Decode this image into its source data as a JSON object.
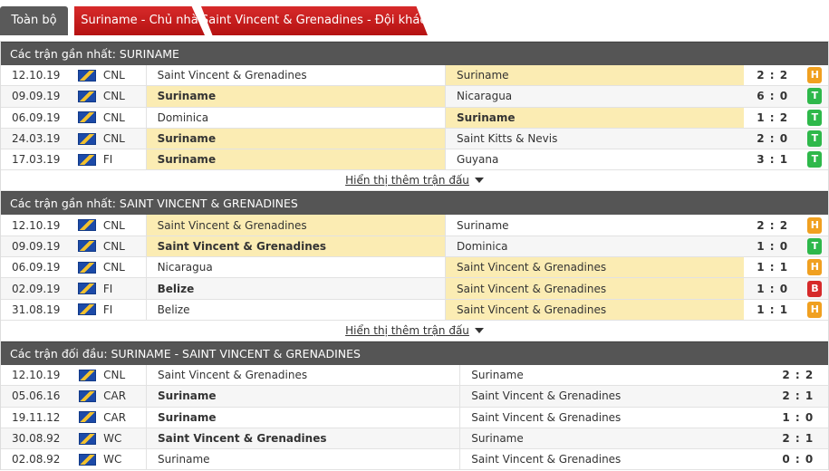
{
  "tabs": [
    {
      "label": "Toàn bộ"
    },
    {
      "label": "Suriname - Chủ nhà"
    },
    {
      "label": "Saint Vincent & Grenadines - Đội khách"
    }
  ],
  "show_more_label": "Hiển thị thêm trận đấu",
  "sections": [
    {
      "title": "Các trận gần nhất: SURINAME",
      "rows": [
        {
          "date": "12.10.19",
          "comp": "CNL",
          "home": "Saint Vincent & Grenadines",
          "home_bold": false,
          "home_hl": false,
          "away": "Suriname",
          "away_bold": false,
          "away_hl": true,
          "score": "2 : 2",
          "result": "H"
        },
        {
          "date": "09.09.19",
          "comp": "CNL",
          "home": "Suriname",
          "home_bold": true,
          "home_hl": true,
          "away": "Nicaragua",
          "away_bold": false,
          "away_hl": false,
          "score": "6 : 0",
          "result": "T"
        },
        {
          "date": "06.09.19",
          "comp": "CNL",
          "home": "Dominica",
          "home_bold": false,
          "home_hl": false,
          "away": "Suriname",
          "away_bold": true,
          "away_hl": true,
          "score": "1 : 2",
          "result": "T"
        },
        {
          "date": "24.03.19",
          "comp": "CNL",
          "home": "Suriname",
          "home_bold": true,
          "home_hl": true,
          "away": "Saint Kitts & Nevis",
          "away_bold": false,
          "away_hl": false,
          "score": "2 : 0",
          "result": "T"
        },
        {
          "date": "17.03.19",
          "comp": "FI",
          "home": "Suriname",
          "home_bold": true,
          "home_hl": true,
          "away": "Guyana",
          "away_bold": false,
          "away_hl": false,
          "score": "3 : 1",
          "result": "T"
        }
      ]
    },
    {
      "title": "Các trận gần nhất: SAINT VINCENT & GRENADINES",
      "rows": [
        {
          "date": "12.10.19",
          "comp": "CNL",
          "home": "Saint Vincent & Grenadines",
          "home_bold": false,
          "home_hl": true,
          "away": "Suriname",
          "away_bold": false,
          "away_hl": false,
          "score": "2 : 2",
          "result": "H"
        },
        {
          "date": "09.09.19",
          "comp": "CNL",
          "home": "Saint Vincent & Grenadines",
          "home_bold": true,
          "home_hl": true,
          "away": "Dominica",
          "away_bold": false,
          "away_hl": false,
          "score": "1 : 0",
          "result": "T"
        },
        {
          "date": "06.09.19",
          "comp": "CNL",
          "home": "Nicaragua",
          "home_bold": false,
          "home_hl": false,
          "away": "Saint Vincent & Grenadines",
          "away_bold": false,
          "away_hl": true,
          "score": "1 : 1",
          "result": "H"
        },
        {
          "date": "02.09.19",
          "comp": "FI",
          "home": "Belize",
          "home_bold": true,
          "home_hl": false,
          "away": "Saint Vincent & Grenadines",
          "away_bold": false,
          "away_hl": true,
          "score": "1 : 0",
          "result": "B"
        },
        {
          "date": "31.08.19",
          "comp": "FI",
          "home": "Belize",
          "home_bold": false,
          "home_hl": false,
          "away": "Saint Vincent & Grenadines",
          "away_bold": false,
          "away_hl": true,
          "score": "1 : 1",
          "result": "H"
        }
      ]
    },
    {
      "title": "Các trận đối đầu: SURINAME - SAINT VINCENT & GRENADINES",
      "rows": [
        {
          "date": "12.10.19",
          "comp": "CNL",
          "home": "Saint Vincent & Grenadines",
          "home_bold": false,
          "home_hl": false,
          "away": "Suriname",
          "away_bold": false,
          "away_hl": false,
          "score": "2 : 2",
          "result": ""
        },
        {
          "date": "05.06.16",
          "comp": "CAR",
          "home": "Suriname",
          "home_bold": true,
          "home_hl": false,
          "away": "Saint Vincent & Grenadines",
          "away_bold": false,
          "away_hl": false,
          "score": "2 : 1",
          "result": ""
        },
        {
          "date": "19.11.12",
          "comp": "CAR",
          "home": "Suriname",
          "home_bold": true,
          "home_hl": false,
          "away": "Saint Vincent & Grenadines",
          "away_bold": false,
          "away_hl": false,
          "score": "1 : 0",
          "result": ""
        },
        {
          "date": "30.08.92",
          "comp": "WC",
          "home": "Saint Vincent & Grenadines",
          "home_bold": true,
          "home_hl": false,
          "away": "Suriname",
          "away_bold": false,
          "away_hl": false,
          "score": "2 : 1",
          "result": ""
        },
        {
          "date": "02.08.92",
          "comp": "WC",
          "home": "Suriname",
          "home_bold": false,
          "home_hl": false,
          "away": "Saint Vincent & Grenadines",
          "away_bold": false,
          "away_hl": false,
          "score": "0 : 0",
          "result": ""
        }
      ]
    }
  ]
}
